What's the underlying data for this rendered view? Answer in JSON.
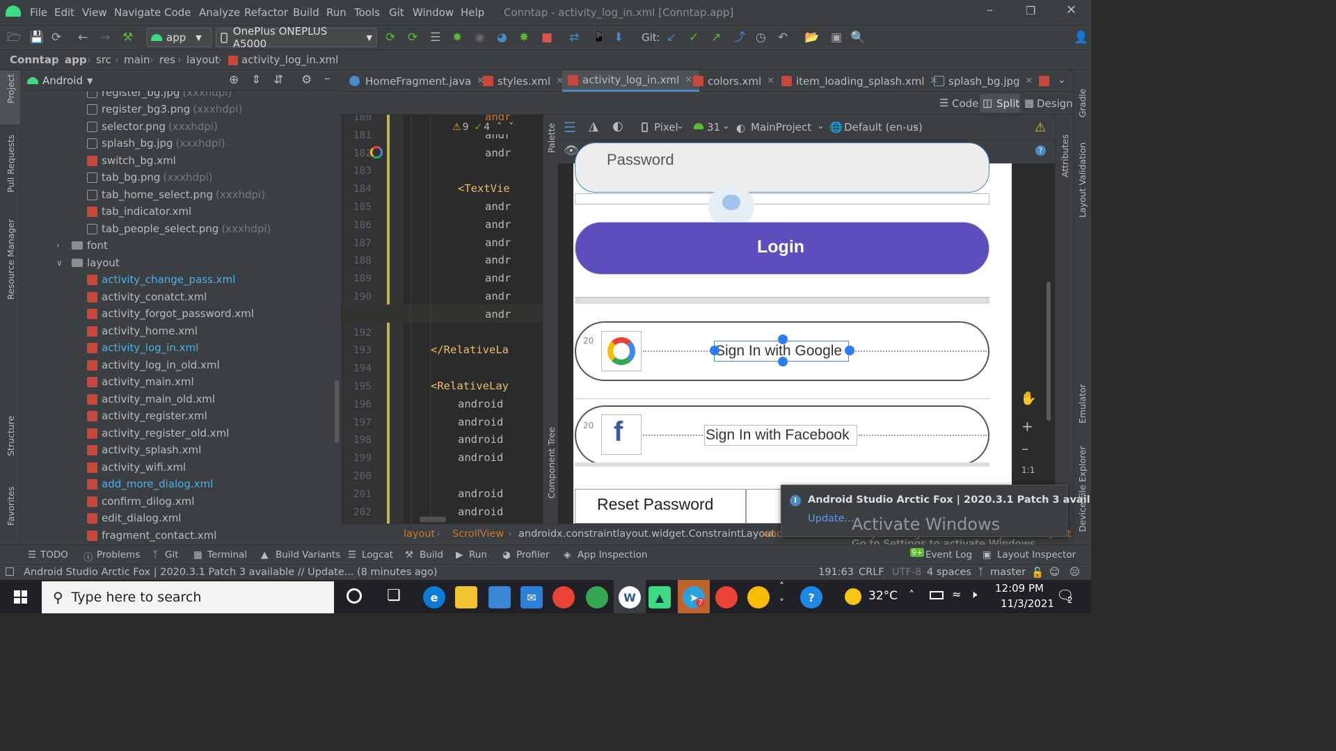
{
  "window": {
    "title": "Conntap - activity_log_in.xml [Conntap.app]",
    "menus": [
      "File",
      "Edit",
      "View",
      "Navigate",
      "Code",
      "Analyze",
      "Refactor",
      "Build",
      "Run",
      "Tools",
      "Git",
      "Window",
      "Help"
    ]
  },
  "toolbar": {
    "run_config": "app",
    "device": "OnePlus ONEPLUS A5000",
    "git_label": "Git:"
  },
  "breadcrumb": [
    "Conntap",
    "app",
    "src",
    "main",
    "res",
    "layout",
    "activity_log_in.xml"
  ],
  "left_strip": [
    "Project",
    "Pull Requests",
    "Resource Manager",
    "Structure",
    "Favorites"
  ],
  "project": {
    "view": "Android",
    "items": [
      {
        "name": "register_bg.jpg",
        "hint": "(xxxhdpi)",
        "type": "img",
        "indent": 2
      },
      {
        "name": "register_bg3.png",
        "hint": "(xxxhdpi)",
        "type": "img",
        "indent": 2
      },
      {
        "name": "selector.png",
        "hint": "(xxxhdpi)",
        "type": "img",
        "indent": 2
      },
      {
        "name": "splash_bg.jpg",
        "hint": "(xxxhdpi)",
        "type": "img",
        "indent": 2
      },
      {
        "name": "switch_bg.xml",
        "hint": "",
        "type": "xml",
        "indent": 2
      },
      {
        "name": "tab_bg.png",
        "hint": "(xxxhdpi)",
        "type": "img",
        "indent": 2
      },
      {
        "name": "tab_home_select.png",
        "hint": "(xxxhdpi)",
        "type": "img",
        "indent": 2
      },
      {
        "name": "tab_indicator.xml",
        "hint": "",
        "type": "xml",
        "indent": 2
      },
      {
        "name": "tab_people_select.png",
        "hint": "(xxxhdpi)",
        "type": "img",
        "indent": 2
      },
      {
        "name": "font",
        "hint": "",
        "type": "folder",
        "indent": 1
      },
      {
        "name": "layout",
        "hint": "",
        "type": "folder-open",
        "indent": 1
      },
      {
        "name": "activity_change_pass.xml",
        "hint": "",
        "type": "xml-mod",
        "indent": 2
      },
      {
        "name": "activity_conatct.xml",
        "hint": "",
        "type": "xml",
        "indent": 2
      },
      {
        "name": "activity_forgot_password.xml",
        "hint": "",
        "type": "xml",
        "indent": 2
      },
      {
        "name": "activity_home.xml",
        "hint": "",
        "type": "xml",
        "indent": 2
      },
      {
        "name": "activity_log_in.xml",
        "hint": "",
        "type": "xml-mod",
        "indent": 2
      },
      {
        "name": "activity_log_in_old.xml",
        "hint": "",
        "type": "xml",
        "indent": 2
      },
      {
        "name": "activity_main.xml",
        "hint": "",
        "type": "xml",
        "indent": 2
      },
      {
        "name": "activity_main_old.xml",
        "hint": "",
        "type": "xml",
        "indent": 2
      },
      {
        "name": "activity_register.xml",
        "hint": "",
        "type": "xml",
        "indent": 2
      },
      {
        "name": "activity_register_old.xml",
        "hint": "",
        "type": "xml",
        "indent": 2
      },
      {
        "name": "activity_splash.xml",
        "hint": "",
        "type": "xml",
        "indent": 2
      },
      {
        "name": "activity_wifi.xml",
        "hint": "",
        "type": "xml",
        "indent": 2
      },
      {
        "name": "add_more_dialog.xml",
        "hint": "",
        "type": "xml-mod",
        "indent": 2
      },
      {
        "name": "confirm_dilog.xml",
        "hint": "",
        "type": "xml",
        "indent": 2
      },
      {
        "name": "edit_dialog.xml",
        "hint": "",
        "type": "xml",
        "indent": 2
      },
      {
        "name": "fragment_contact.xml",
        "hint": "",
        "type": "xml",
        "indent": 2
      }
    ]
  },
  "tabs": [
    "HomeFragment.java",
    "styles.xml",
    "activity_log_in.xml",
    "colors.xml",
    "item_loading_splash.xml",
    "splash_bg.jpg"
  ],
  "editor_modes": [
    "Code",
    "Split",
    "Design"
  ],
  "inspection": {
    "warnings": "9",
    "ok": "4"
  },
  "code": {
    "lines": [
      {
        "n": "180",
        "t": "andr",
        "c": "#cc7832",
        "i": 5
      },
      {
        "n": "181",
        "t": "andr",
        "c": "#bababa",
        "i": 5
      },
      {
        "n": "182",
        "t": "andr",
        "c": "#bababa",
        "i": 5
      },
      {
        "n": "183",
        "t": "",
        "c": "#bababa",
        "i": 0
      },
      {
        "n": "184",
        "t": "<TextVie",
        "c": "#e8bf6a",
        "i": 4
      },
      {
        "n": "185",
        "t": "andr",
        "c": "#bababa",
        "i": 5
      },
      {
        "n": "186",
        "t": "andr",
        "c": "#bababa",
        "i": 5
      },
      {
        "n": "187",
        "t": "andr",
        "c": "#bababa",
        "i": 5
      },
      {
        "n": "188",
        "t": "andr",
        "c": "#bababa",
        "i": 5
      },
      {
        "n": "189",
        "t": "andr",
        "c": "#bababa",
        "i": 5
      },
      {
        "n": "190",
        "t": "andr",
        "c": "#bababa",
        "i": 5
      },
      {
        "n": "191",
        "t": "andr",
        "c": "#bababa",
        "i": 5
      },
      {
        "n": "192",
        "t": "",
        "c": "#bababa",
        "i": 0
      },
      {
        "n": "193",
        "t": "</RelativeLa",
        "c": "#e8bf6a",
        "i": 3
      },
      {
        "n": "194",
        "t": "",
        "c": "#bababa",
        "i": 0
      },
      {
        "n": "195",
        "t": "<RelativeLay",
        "c": "#e8bf6a",
        "i": 3
      },
      {
        "n": "196",
        "t": "android",
        "c": "#bababa",
        "i": 4
      },
      {
        "n": "197",
        "t": "android",
        "c": "#bababa",
        "i": 4
      },
      {
        "n": "198",
        "t": "android",
        "c": "#bababa",
        "i": 4
      },
      {
        "n": "199",
        "t": "android",
        "c": "#bababa",
        "i": 4
      },
      {
        "n": "200",
        "t": "",
        "c": "#bababa",
        "i": 0
      },
      {
        "n": "201",
        "t": "android",
        "c": "#bababa",
        "i": 4
      },
      {
        "n": "202",
        "t": "android",
        "c": "#bababa",
        "i": 4
      }
    ]
  },
  "design_toolbar": {
    "device": "Pixel",
    "api": "31",
    "theme": "MainProject",
    "locale": "Default (en-us)"
  },
  "preview": {
    "password_placeholder": "Password",
    "login": "Login",
    "google": "Sign In with Google",
    "facebook": "Sign In with Facebook",
    "margin": "20",
    "reset": "Reset Password",
    "login_color": "#5a4fbd"
  },
  "side_tools": {
    "palette": "Palette",
    "component_tree": "Component Tree",
    "attributes": "Attributes",
    "layout_validation": "Layout Validation",
    "gradle": "Gradle",
    "emulator": "Emulator",
    "device_file": "Device File Explorer"
  },
  "zoom": {
    "one_to_one": "1:1"
  },
  "navbar": [
    "layout",
    "ScrollView",
    "androidx.constraintlayout.widget.ConstraintLayout",
    "androidx.constraintlayout.widget.ConstraintLayout",
    "LinearLayout"
  ],
  "notification": {
    "title": "Android Studio Arctic Fox | 2020.3.1 Patch 3 avail",
    "action": "Update..."
  },
  "watermark": {
    "line1": "Activate Windows",
    "line2": "Go to Settings to activate Windows."
  },
  "bottom_tools": [
    "TODO",
    "Problems",
    "Git",
    "Terminal",
    "Build Variants",
    "Logcat",
    "Build",
    "Run",
    "Profiler",
    "App Inspection",
    "Event Log",
    "Layout Inspector"
  ],
  "event_badge": "9+",
  "status": {
    "message": "Android Studio Arctic Fox | 2020.3.1 Patch 3 available // Update... (8 minutes ago)",
    "position": "191:63",
    "line_sep": "CRLF",
    "encoding": "UTF-8",
    "indent": "4 spaces",
    "branch": "master"
  },
  "taskbar": {
    "search": "Type here to search",
    "temp": "32°C",
    "time": "12:09 PM",
    "date": "11/3/2021",
    "notif_count": "2",
    "telegram_badge": "7"
  }
}
